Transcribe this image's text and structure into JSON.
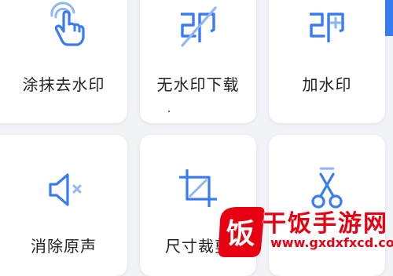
{
  "tools": [
    {
      "label": "涂抹去水印",
      "icon": "tap-hand-icon"
    },
    {
      "label": "无水印下载",
      "icon": "no-watermark-icon"
    },
    {
      "label": "加水印",
      "icon": "add-watermark-icon"
    },
    {
      "label": "消除原声",
      "icon": "mute-speaker-icon"
    },
    {
      "label": "尺寸裁剪",
      "icon": "crop-icon"
    },
    {
      "label": "",
      "icon": "scissors-icon"
    }
  ],
  "watermark": {
    "brand": "干饭手游网",
    "url": "www.gxdxfxcd.com",
    "logo_char": "饭"
  },
  "colors": {
    "accent": "#3a7cf0",
    "accent_light": "#8fb6f7",
    "watermark_red": "#e60012"
  }
}
